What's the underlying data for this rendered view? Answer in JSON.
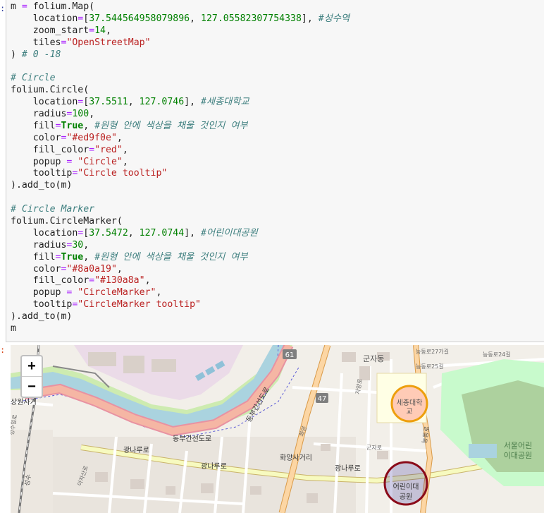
{
  "code_lines": [
    [
      [
        "v",
        "m "
      ],
      [
        "o",
        "="
      ],
      [
        "v",
        " folium.Map("
      ]
    ],
    [
      [
        "v",
        "    location"
      ],
      [
        "o",
        "="
      ],
      [
        "v",
        "["
      ],
      [
        "n",
        "37.544564958079896"
      ],
      [
        "v",
        ", "
      ],
      [
        "n",
        "127.05582307754338"
      ],
      [
        "v",
        "], "
      ],
      [
        "c",
        "#성수역"
      ]
    ],
    [
      [
        "v",
        "    zoom_start"
      ],
      [
        "o",
        "="
      ],
      [
        "n",
        "14"
      ],
      [
        "v",
        ","
      ]
    ],
    [
      [
        "v",
        "    tiles"
      ],
      [
        "o",
        "="
      ],
      [
        "s",
        "\"OpenStreetMap\""
      ]
    ],
    [
      [
        "v",
        ") "
      ],
      [
        "c",
        "# 0 -18"
      ]
    ],
    [
      [
        "v",
        ""
      ]
    ],
    [
      [
        "c",
        "# Circle"
      ]
    ],
    [
      [
        "v",
        "folium.Circle("
      ]
    ],
    [
      [
        "v",
        "    location"
      ],
      [
        "o",
        "="
      ],
      [
        "v",
        "["
      ],
      [
        "n",
        "37.5511"
      ],
      [
        "v",
        ", "
      ],
      [
        "n",
        "127.0746"
      ],
      [
        "v",
        "], "
      ],
      [
        "c",
        "#세종대학교"
      ]
    ],
    [
      [
        "v",
        "    radius"
      ],
      [
        "o",
        "="
      ],
      [
        "n",
        "100"
      ],
      [
        "v",
        ","
      ]
    ],
    [
      [
        "v",
        "    fill"
      ],
      [
        "o",
        "="
      ],
      [
        "k",
        "True"
      ],
      [
        "v",
        ", "
      ],
      [
        "c",
        "#원형 안에 색상을 채울 것인지 여부"
      ]
    ],
    [
      [
        "v",
        "    color"
      ],
      [
        "o",
        "="
      ],
      [
        "s",
        "\"#ed9f0e\""
      ],
      [
        "v",
        ","
      ]
    ],
    [
      [
        "v",
        "    fill_color"
      ],
      [
        "o",
        "="
      ],
      [
        "s",
        "\"red\""
      ],
      [
        "v",
        ","
      ]
    ],
    [
      [
        "v",
        "    popup "
      ],
      [
        "o",
        "="
      ],
      [
        "v",
        " "
      ],
      [
        "s",
        "\"Circle\""
      ],
      [
        "v",
        ","
      ]
    ],
    [
      [
        "v",
        "    tooltip"
      ],
      [
        "o",
        "="
      ],
      [
        "s",
        "\"Circle tooltip\""
      ]
    ],
    [
      [
        "v",
        ")."
      ],
      [
        "v",
        "add_to(m)"
      ]
    ],
    [
      [
        "v",
        ""
      ]
    ],
    [
      [
        "c",
        "# Circle Marker"
      ]
    ],
    [
      [
        "v",
        "folium.CircleMarker("
      ]
    ],
    [
      [
        "v",
        "    location"
      ],
      [
        "o",
        "="
      ],
      [
        "v",
        "["
      ],
      [
        "n",
        "37.5472"
      ],
      [
        "v",
        ", "
      ],
      [
        "n",
        "127.0744"
      ],
      [
        "v",
        "], "
      ],
      [
        "c",
        "#어린이대공원"
      ]
    ],
    [
      [
        "v",
        "    radius"
      ],
      [
        "o",
        "="
      ],
      [
        "n",
        "30"
      ],
      [
        "v",
        ","
      ]
    ],
    [
      [
        "v",
        "    fill"
      ],
      [
        "o",
        "="
      ],
      [
        "k",
        "True"
      ],
      [
        "v",
        ", "
      ],
      [
        "c",
        "#원형 안에 색상을 채울 것인지 여부"
      ]
    ],
    [
      [
        "v",
        "    color"
      ],
      [
        "o",
        "="
      ],
      [
        "s",
        "\"#8a0a19\""
      ],
      [
        "v",
        ","
      ]
    ],
    [
      [
        "v",
        "    fill_color"
      ],
      [
        "o",
        "="
      ],
      [
        "s",
        "\"#130a8a\""
      ],
      [
        "v",
        ","
      ]
    ],
    [
      [
        "v",
        "    popup "
      ],
      [
        "o",
        "="
      ],
      [
        "v",
        " "
      ],
      [
        "s",
        "\"CircleMarker\""
      ],
      [
        "v",
        ","
      ]
    ],
    [
      [
        "v",
        "    tooltip"
      ],
      [
        "o",
        "="
      ],
      [
        "s",
        "\"CircleMarker tooltip\""
      ]
    ],
    [
      [
        "v",
        ")."
      ],
      [
        "v",
        "add_to(m)"
      ]
    ],
    [
      [
        "v",
        "m"
      ]
    ]
  ],
  "map": {
    "zoom_in": "+",
    "zoom_out": "−",
    "circle": {
      "stroke": "#ed9f0e",
      "fill": "#ff6b5e",
      "label": "세종대학교"
    },
    "circle_marker": {
      "stroke": "#8a0a19",
      "fill": "#130a8a",
      "label": "어린이대공원"
    },
    "labels": {
      "gunjadong": "군자동",
      "sejong": "세종대학",
      "sejong2": "교",
      "park1": "서울어린",
      "park2": "이대공원",
      "children1": "어린이대",
      "children2": "공원",
      "dongbu": "동부간선도로",
      "dongbu_v": "동부간선도로",
      "gwangnaru1": "광나루로",
      "gwangnaru2": "광나루로",
      "gwangnaru3": "광나루로",
      "hwayang": "화양사거리",
      "sangwon": "상원사거",
      "seongsu": "성수",
      "route61": "61",
      "route47": "47",
      "neungdong": "능동로",
      "neungdong24": "능동로24길",
      "neungdong25": "능동로25길",
      "neungdong27": "능동로27가길",
      "jayang": "자양로",
      "aeo": "아차산로",
      "hwayang10": "화양",
      "gunja": "군자로",
      "seongsuil": "성수일로"
    }
  }
}
